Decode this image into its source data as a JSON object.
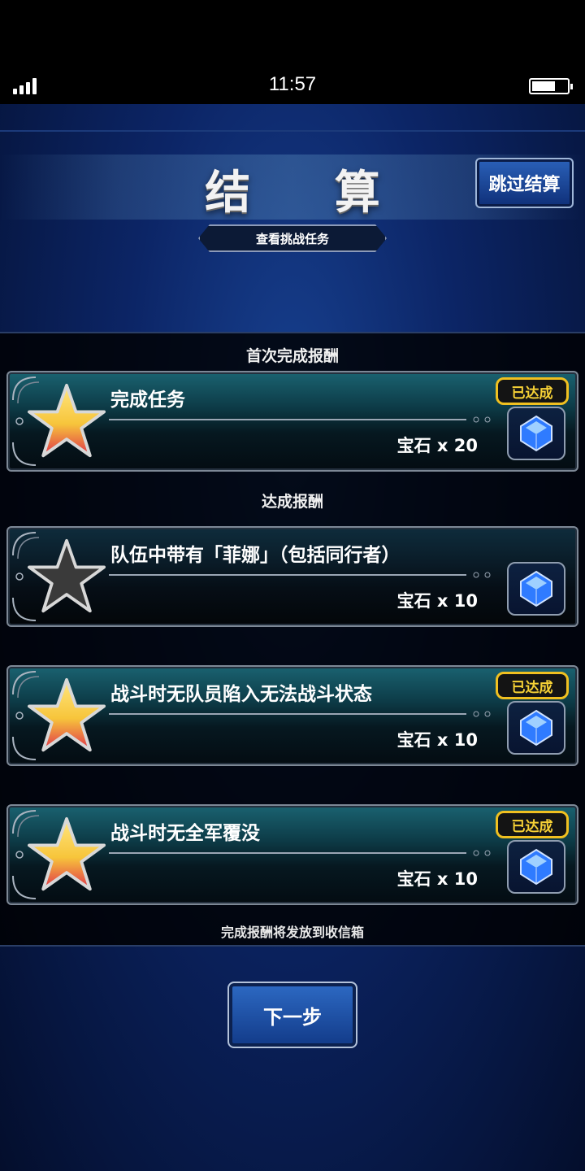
{
  "status_bar": {
    "time": "11:57"
  },
  "header": {
    "title": "结 算",
    "skip_label": "跳过结算",
    "mission_label": "查看挑战任务"
  },
  "sections": {
    "first_clear": "首次完成报酬",
    "achievement": "达成报酬"
  },
  "cards": [
    {
      "task": "完成任务",
      "reward": "宝石 x 20",
      "achieved": true,
      "badge": "已达成"
    },
    {
      "task": "队伍中带有「菲娜」（包括同行者）",
      "reward": "宝石 x 10",
      "achieved": false,
      "badge": ""
    },
    {
      "task": "战斗时无队员陷入无法战斗状态",
      "reward": "宝石 x 10",
      "achieved": true,
      "badge": "已达成"
    },
    {
      "task": "战斗时无全军覆没",
      "reward": "宝石 x 10",
      "achieved": true,
      "badge": "已达成"
    }
  ],
  "footer_note": "完成报酬将发放到收信箱",
  "next_label": "下一步",
  "colors": {
    "badge_gold": "#f0c020",
    "star_gold": "#f7c53b",
    "star_red": "#e0344a",
    "gem_blue": "#2f7bff"
  },
  "icons": [
    "signal-icon",
    "battery-icon",
    "star-icon",
    "gem-icon"
  ]
}
